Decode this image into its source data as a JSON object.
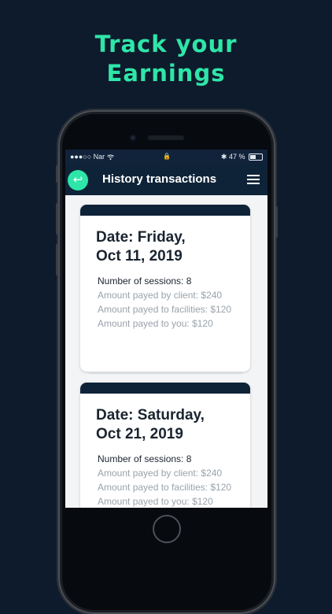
{
  "headline": {
    "line1": "Track your",
    "line2": "Earnings"
  },
  "status_bar": {
    "carrier": "●●●○○ Nar ",
    "lock": "🔒",
    "bluetooth": "✱",
    "battery": "47 %"
  },
  "app_bar": {
    "back_glyph": "↩",
    "title": "History transactions"
  },
  "transactions": [
    {
      "date_line1": "Date: Friday,",
      "date_line2": "Oct 11, 2019",
      "sessions": "Number of sessions: 8",
      "client": "Amount payed by client: $240",
      "facilities": "Amount payed to facilities: $120",
      "you": "Amount payed to you: $120"
    },
    {
      "date_line1": "Date: Saturday,",
      "date_line2": "Oct 21, 2019",
      "sessions": "Number of sessions: 8",
      "client": "Amount payed by client: $240",
      "facilities": "Amount payed to facilities: $120",
      "you": "Amount payed to you: $120"
    }
  ],
  "colors": {
    "background": "#0e1b2c",
    "accent": "#2ee6a8",
    "app_bar": "#0f2338"
  },
  "icons": {
    "back": "back-arrow-icon",
    "menu": "hamburger-menu-icon",
    "wifi": "wifi-icon",
    "lock": "lock-icon",
    "bluetooth": "bluetooth-icon",
    "battery": "battery-icon"
  }
}
